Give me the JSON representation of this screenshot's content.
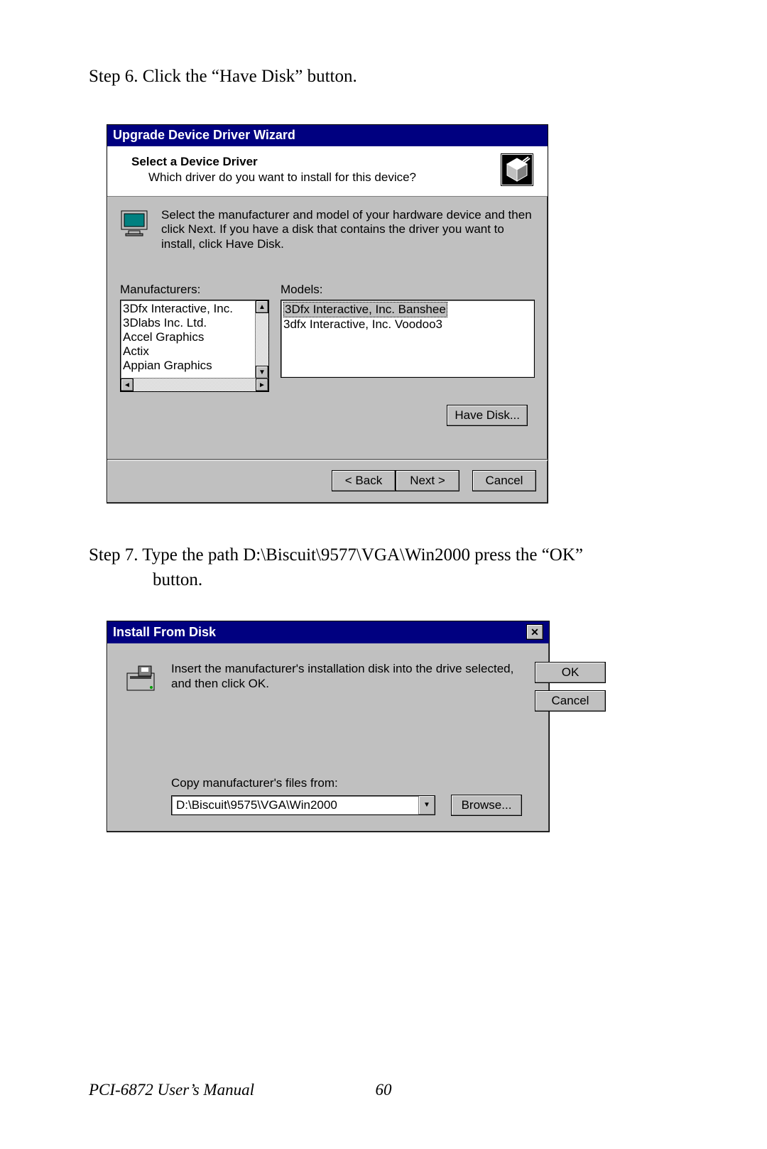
{
  "step6": "Step 6.  Click the “Have Disk” button.",
  "step7_line1": "Step 7.  Type the path D:\\Biscuit\\9577\\VGA\\Win2000  press the “OK”",
  "step7_line2": "button.",
  "wizard": {
    "title": "Upgrade Device Driver Wizard",
    "heading": "Select a Device Driver",
    "subheading": "Which driver do you want to install for this device?",
    "instruction": "Select the manufacturer and model of your hardware device and then click Next. If you have a disk that contains the driver you want to install, click Have Disk.",
    "manufacturers_label": "Manufacturers:",
    "models_label": "Models:",
    "manufacturers": [
      "3Dfx Interactive, Inc.",
      "3Dlabs Inc. Ltd.",
      "Accel Graphics",
      "Actix",
      "Appian Graphics"
    ],
    "models": [
      "3Dfx Interactive, Inc. Banshee",
      "3dfx Interactive, Inc. Voodoo3"
    ],
    "have_disk": "Have Disk...",
    "back": "< Back",
    "next": "Next >",
    "cancel": "Cancel"
  },
  "install": {
    "title": "Install From Disk",
    "message": "Insert the manufacturer's installation disk into the drive selected, and then click OK.",
    "ok": "OK",
    "cancel": "Cancel",
    "copy_label": "Copy manufacturer's files from:",
    "path_value": "D:\\Biscuit\\9575\\VGA\\Win2000",
    "browse": "Browse..."
  },
  "footer_text": "PCI-6872 User’s Manual",
  "page_number": "60"
}
